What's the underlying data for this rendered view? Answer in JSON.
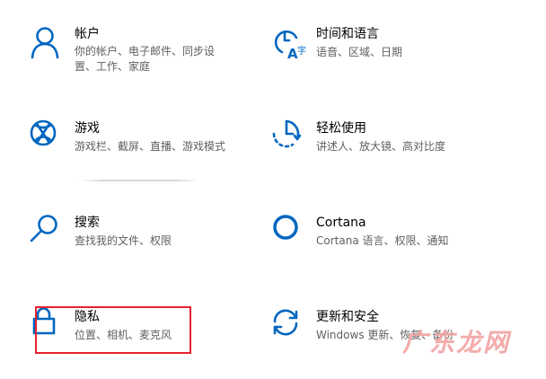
{
  "settings": [
    {
      "title": "帐户",
      "desc": [
        "你的帐户、电子邮件、同步设",
        "置、工作、家庭"
      ],
      "icon": "person-icon"
    },
    {
      "title": "时间和语言",
      "desc": [
        "语音、区域、日期"
      ],
      "icon": "time-language-icon"
    },
    {
      "title": "游戏",
      "desc": [
        "游戏栏、截屏、直播、游戏模式"
      ],
      "icon": "xbox-icon"
    },
    {
      "title": "轻松使用",
      "desc": [
        "讲述人、放大镜、高对比度"
      ],
      "icon": "ease-of-access-icon"
    },
    {
      "title": "搜索",
      "desc": [
        "查找我的文件、权限"
      ],
      "icon": "search-icon"
    },
    {
      "title": "Cortana",
      "desc": [
        "Cortana 语言、权限、通知"
      ],
      "icon": "cortana-icon"
    },
    {
      "title": "隐私",
      "desc": [
        "位置、相机、麦克风"
      ],
      "icon": "lock-icon"
    },
    {
      "title": "更新和安全",
      "desc": [
        "Windows 更新、恢复、备份"
      ],
      "icon": "update-icon"
    }
  ],
  "watermark": "广东龙网",
  "colors": {
    "accent": "#0067c0",
    "highlight": "#e5222e",
    "watermark": "#f2a3a3"
  }
}
